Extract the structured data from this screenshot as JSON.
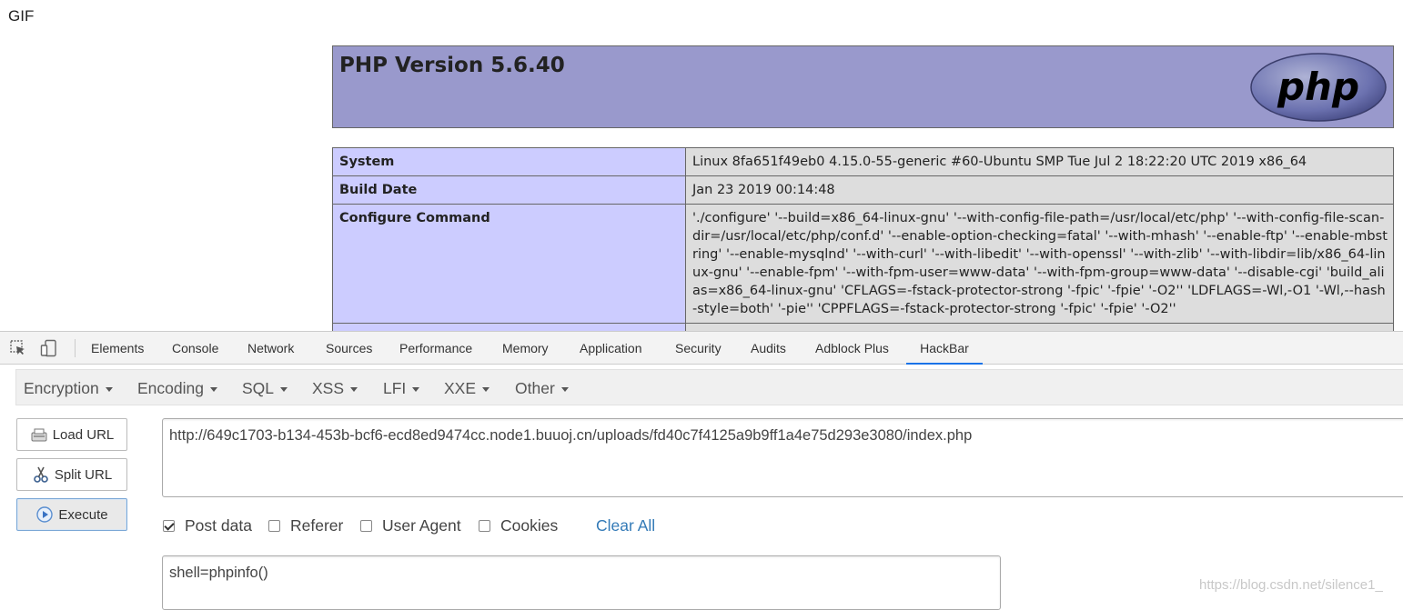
{
  "page": {
    "gif_label": "GIF",
    "php_title": "PHP Version 5.6.40",
    "logo_text": "php",
    "info_rows": [
      {
        "label": "System",
        "value": "Linux 8fa651f49eb0 4.15.0-55-generic #60-Ubuntu SMP Tue Jul 2 18:22:20 UTC 2019 x86_64"
      },
      {
        "label": "Build Date",
        "value": "Jan 23 2019 00:14:48"
      },
      {
        "label": "Configure Command",
        "value": "'./configure' '--build=x86_64-linux-gnu' '--with-config-file-path=/usr/local/etc/php' '--with-config-file-scan-dir=/usr/local/etc/php/conf.d' '--enable-option-checking=fatal' '--with-mhash' '--enable-ftp' '--enable-mbstring' '--enable-mysqlnd' '--with-curl' '--with-libedit' '--with-openssl' '--with-zlib' '--with-libdir=lib/x86_64-linux-gnu' '--enable-fpm' '--with-fpm-user=www-data' '--with-fpm-group=www-data' '--disable-cgi' 'build_alias=x86_64-linux-gnu' 'CFLAGS=-fstack-protector-strong '-fpic' '-fpie' '-O2'' 'LDFLAGS=-Wl,-O1 '-Wl,--hash-style=both' '-pie'' 'CPPFLAGS=-fstack-protector-strong '-fpic' '-fpie' '-O2''"
      }
    ]
  },
  "devtools": {
    "tabs": [
      "Elements",
      "Console",
      "Network",
      "Sources",
      "Performance",
      "Memory",
      "Application",
      "Security",
      "Audits",
      "Adblock Plus",
      "HackBar"
    ],
    "active_tab": "HackBar"
  },
  "hackbar": {
    "menus": [
      "Encryption",
      "Encoding",
      "SQL",
      "XSS",
      "LFI",
      "XXE",
      "Other"
    ],
    "buttons": {
      "load_url": "Load URL",
      "split_url": "Split URL",
      "execute": "Execute"
    },
    "url": "http://649c1703-b134-453b-bcf6-ecd8ed9474cc.node1.buuoj.cn/uploads/fd40c7f4125a9b9ff1a4e75d293e3080/index.php",
    "checks": [
      {
        "label": "Post data",
        "checked": true
      },
      {
        "label": "Referer",
        "checked": false
      },
      {
        "label": "User Agent",
        "checked": false
      },
      {
        "label": "Cookies",
        "checked": false
      }
    ],
    "clear_all": "Clear All",
    "post_data": "shell=phpinfo()"
  },
  "watermark": "https://blog.csdn.net/silence1_",
  "colors": {
    "php_header": "#9999cc",
    "label_cell": "#ccccff",
    "value_cell": "#dddddd",
    "active_tab_underline": "#1a73e8",
    "link": "#337ab7"
  }
}
